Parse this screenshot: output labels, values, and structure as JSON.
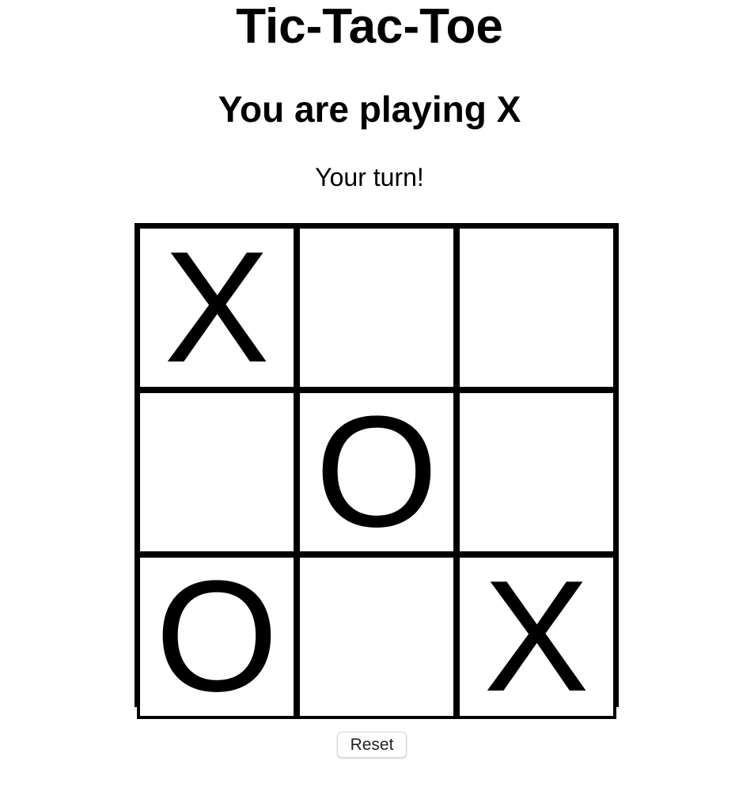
{
  "header": {
    "title": "Tic-Tac-Toe",
    "subtitle": "You are playing X",
    "status": "Your turn!"
  },
  "board": {
    "cells": [
      "X",
      "",
      "",
      "",
      "O",
      "",
      "O",
      "",
      "X"
    ]
  },
  "controls": {
    "reset_label": "Reset"
  }
}
